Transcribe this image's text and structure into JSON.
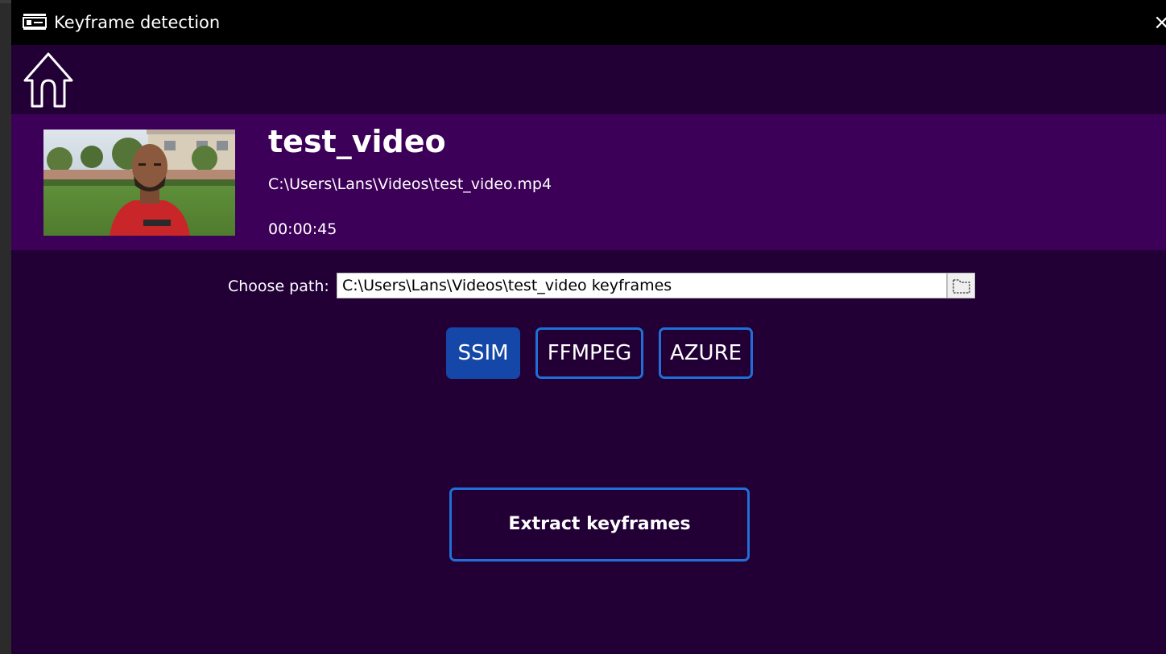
{
  "window": {
    "title": "Keyframe detection",
    "close_glyph": "×",
    "app_icon": "keyframe-app-icon"
  },
  "nav": {
    "home_icon": "home-icon"
  },
  "video": {
    "title": "test_video",
    "path": "C:\\Users\\Lans\\Videos\\test_video.mp4",
    "duration": "00:00:45",
    "thumbnail": "video-thumbnail"
  },
  "output": {
    "label": "Choose path:",
    "value": "C:\\Users\\Lans\\Videos\\test_video keyframes",
    "browse_icon": "folder-icon"
  },
  "methods": [
    {
      "label": "SSIM",
      "selected": true
    },
    {
      "label": "FFMPEG",
      "selected": false
    },
    {
      "label": "AZURE",
      "selected": false
    }
  ],
  "actions": {
    "extract_label": "Extract keyframes"
  },
  "colors": {
    "window_bg": "#220036",
    "banner_bg": "#3d0058",
    "titlebar_bg": "#000000",
    "accent_border": "#1f6fd6",
    "selected_fill": "#1547a8"
  }
}
